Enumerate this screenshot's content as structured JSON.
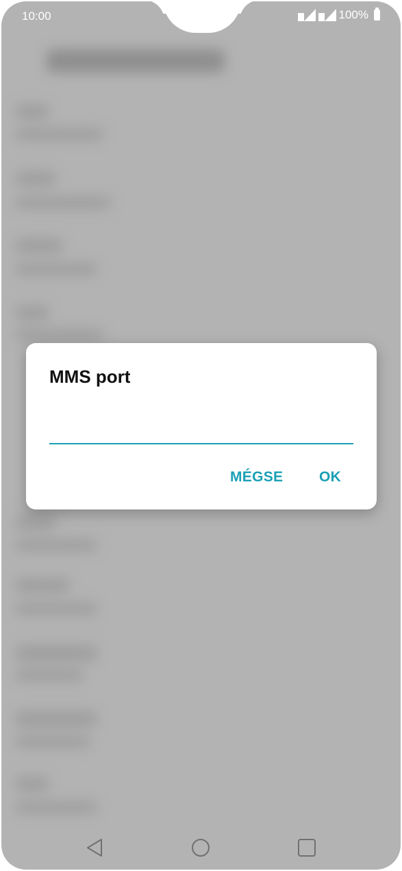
{
  "status_bar": {
    "time": "10:00",
    "battery": "100%"
  },
  "dialog": {
    "title": "MMS port",
    "input_value": "",
    "cancel_label": "MÉGSE",
    "ok_label": "OK"
  },
  "nav": {
    "back": "back-icon",
    "home": "home-icon",
    "recents": "recents-icon"
  },
  "colors": {
    "accent": "#1aa0b4",
    "background": "#b3b3b3"
  }
}
